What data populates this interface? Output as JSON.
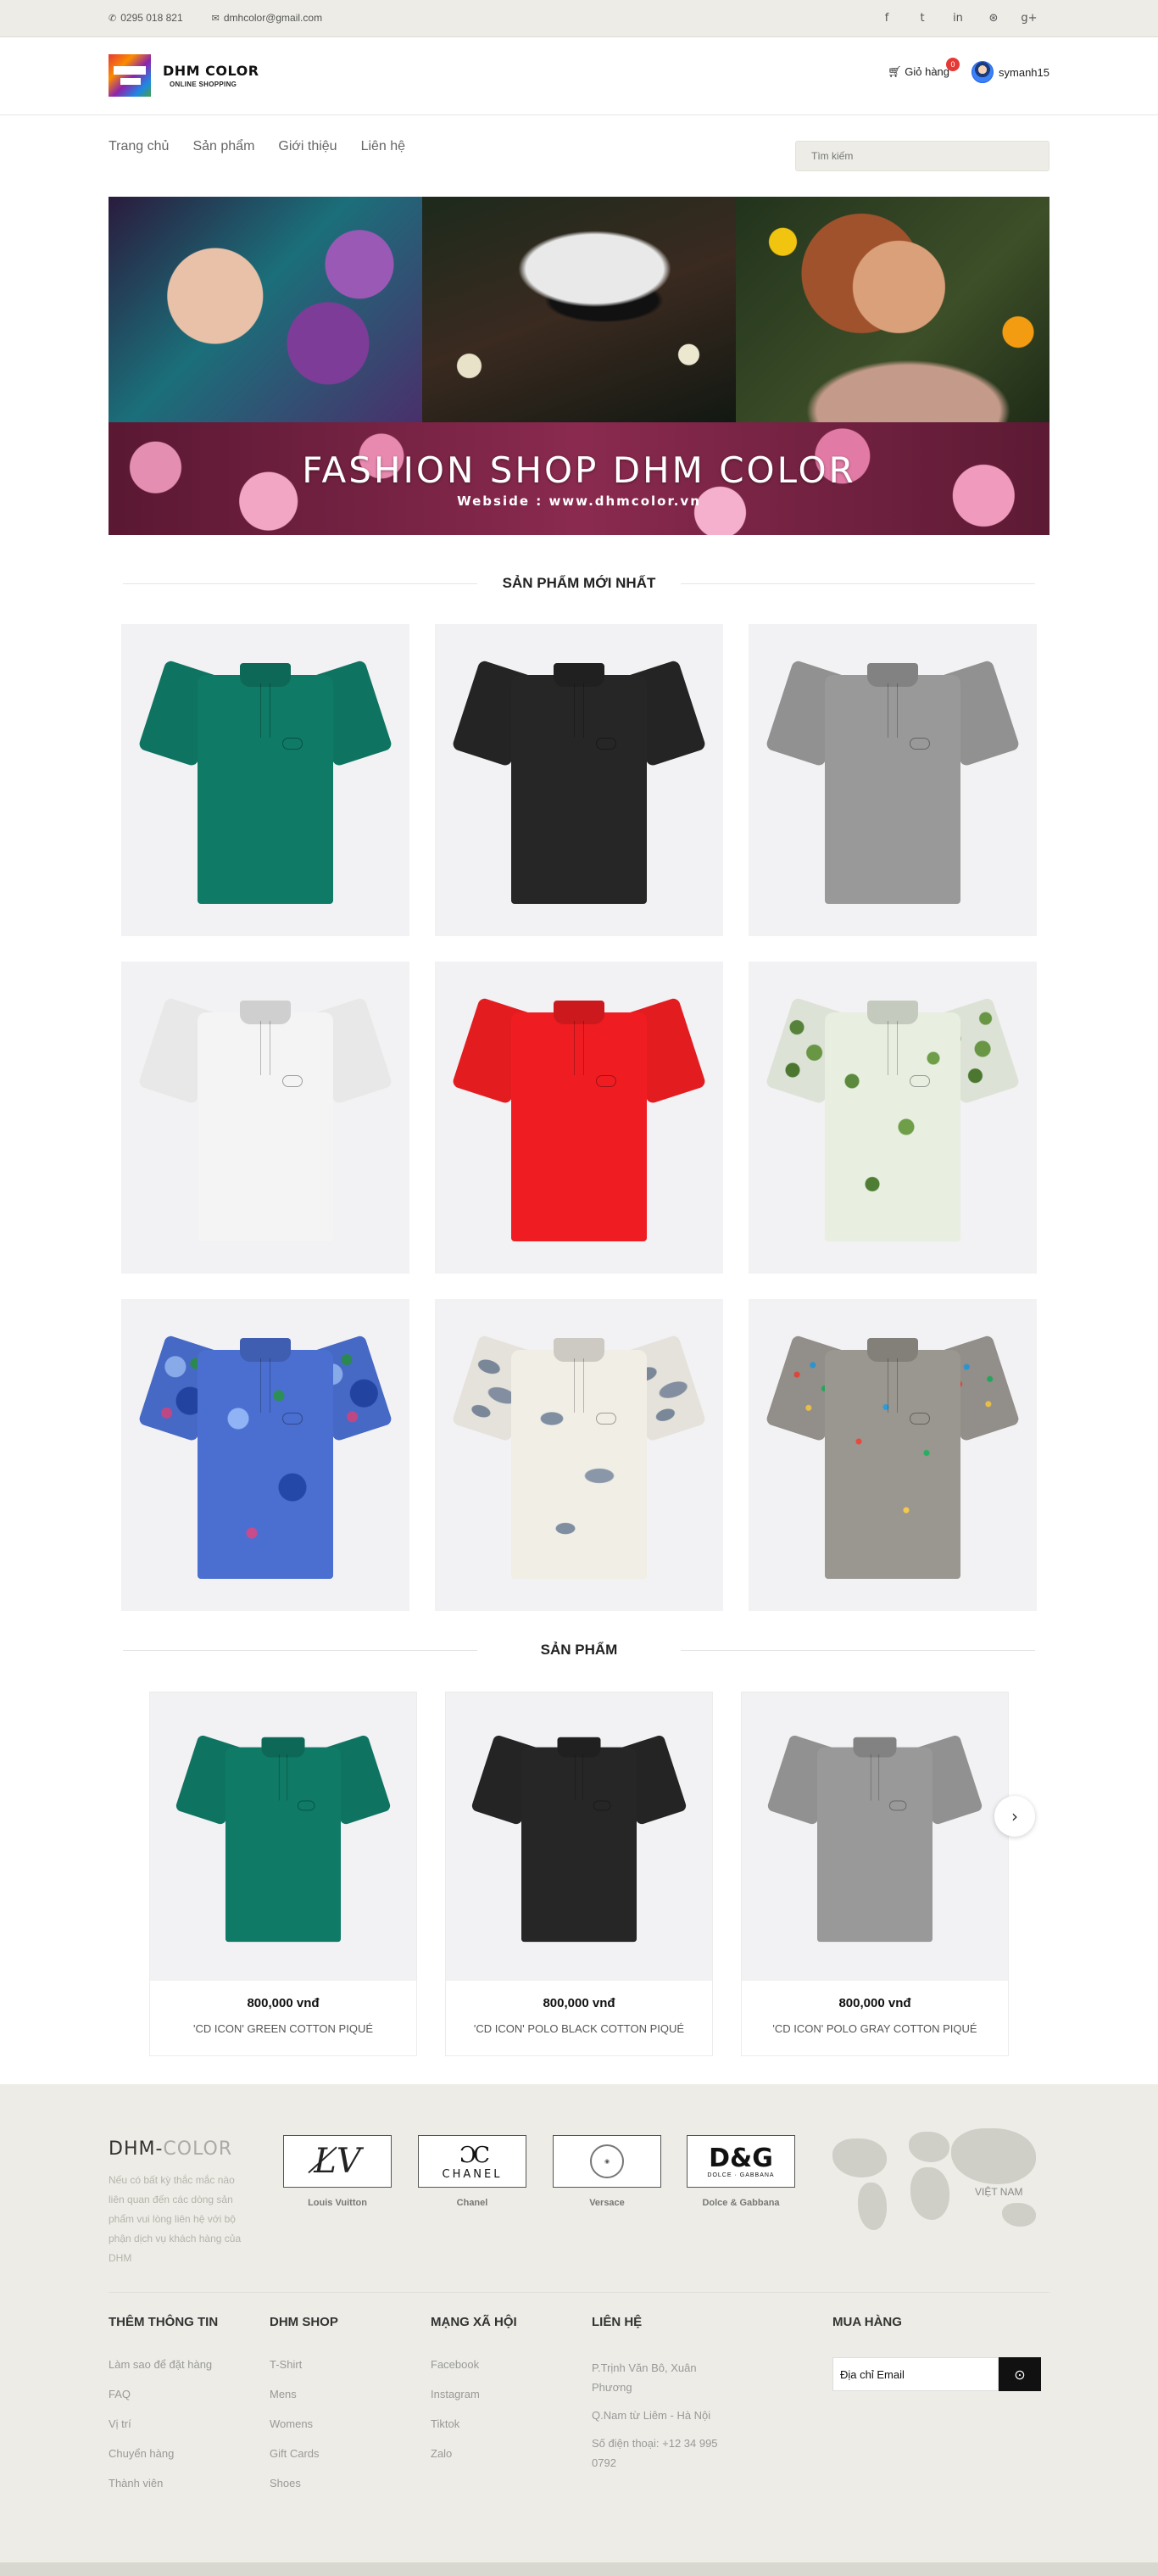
{
  "topbar": {
    "phone": "0295 018 821",
    "email": "dmhcolor@gmail.com",
    "social": [
      "facebook-icon",
      "twitter-icon",
      "linkedin-icon",
      "dribbble-icon",
      "google-plus-icon"
    ]
  },
  "header": {
    "brand_name": "DHM COLOR",
    "brand_sub": "ONLINE SHOPPING",
    "cart_label": "Giỏ hàng",
    "cart_count": "0",
    "username": "symanh15"
  },
  "nav": {
    "items": [
      {
        "label": "Trang chủ"
      },
      {
        "label": "Sản phẩm"
      },
      {
        "label": "Giới thiệu"
      },
      {
        "label": "Liên hệ"
      }
    ],
    "search_placeholder": "Tìm kiếm"
  },
  "banner": {
    "title": "FASHION SHOP DHM COLOR",
    "subtitle": "Webside : www.dhmcolor.vn"
  },
  "latest": {
    "title": "SẢN PHẨM MỚI NHẤT",
    "items": [
      {
        "color": "#0f7a66",
        "pattern": "plain"
      },
      {
        "color": "#262626",
        "pattern": "plain"
      },
      {
        "color": "#999999",
        "pattern": "plain"
      },
      {
        "color": "#f4f4f4",
        "pattern": "plain"
      },
      {
        "color": "#ef1d22",
        "pattern": "plain"
      },
      {
        "color": "#e8eee0",
        "pattern": "leaves"
      },
      {
        "color": "#4a6fd0",
        "pattern": "swirl"
      },
      {
        "color": "#f1eee6",
        "pattern": "splotch"
      },
      {
        "color": "#9a9690",
        "pattern": "paint"
      }
    ]
  },
  "products": {
    "title": "SẢN PHẨM",
    "items": [
      {
        "price": "800,000 vnđ",
        "name": "'CD ICON' GREEN COTTON PIQUÉ",
        "color": "#0f7a66"
      },
      {
        "price": "800,000 vnđ",
        "name": "'CD ICON' POLO BLACK COTTON PIQUÉ",
        "color": "#262626"
      },
      {
        "price": "800,000 vnđ",
        "name": "'CD ICON' POLO GRAY COTTON PIQUÉ",
        "color": "#999999"
      }
    ],
    "next_icon": "chevron-right-icon"
  },
  "footer": {
    "brand_main": "DHM-",
    "brand_muted": "COLOR",
    "description": "Nếu có bất kỳ thắc mắc nào liên quan đến các dòng sản phẩm vui lòng liên hệ với bộ phận dịch vụ khách hàng của DHM",
    "brands": [
      {
        "caption": "Louis Vuitton"
      },
      {
        "caption": "Chanel"
      },
      {
        "caption": "Versace"
      },
      {
        "caption": "Dolce & Gabbana"
      }
    ],
    "map_label": "VIỆT NAM",
    "columns": {
      "info": {
        "title": "THÊM THÔNG TIN",
        "links": [
          "Làm sao để đặt hàng",
          "FAQ",
          "Vị trí",
          "Chuyển hàng",
          "Thành viên"
        ]
      },
      "shop": {
        "title": "DHM SHOP",
        "links": [
          "T-Shirt",
          "Mens",
          "Womens",
          "Gift Cards",
          "Shoes"
        ]
      },
      "social": {
        "title": "MẠNG XÃ HỘI",
        "links": [
          "Facebook",
          "Instagram",
          "Tiktok",
          "Zalo"
        ]
      },
      "contact": {
        "title": "LIÊN HỆ",
        "lines": [
          "P.Trịnh Văn Bô, Xuân Phương",
          "Q.Nam từ Liêm - Hà Nội",
          "Số điện thoại: +12 34 995 0792"
        ]
      },
      "subscribe": {
        "title": "MUA HÀNG",
        "input_value": "Địa chỉ Email"
      }
    }
  }
}
